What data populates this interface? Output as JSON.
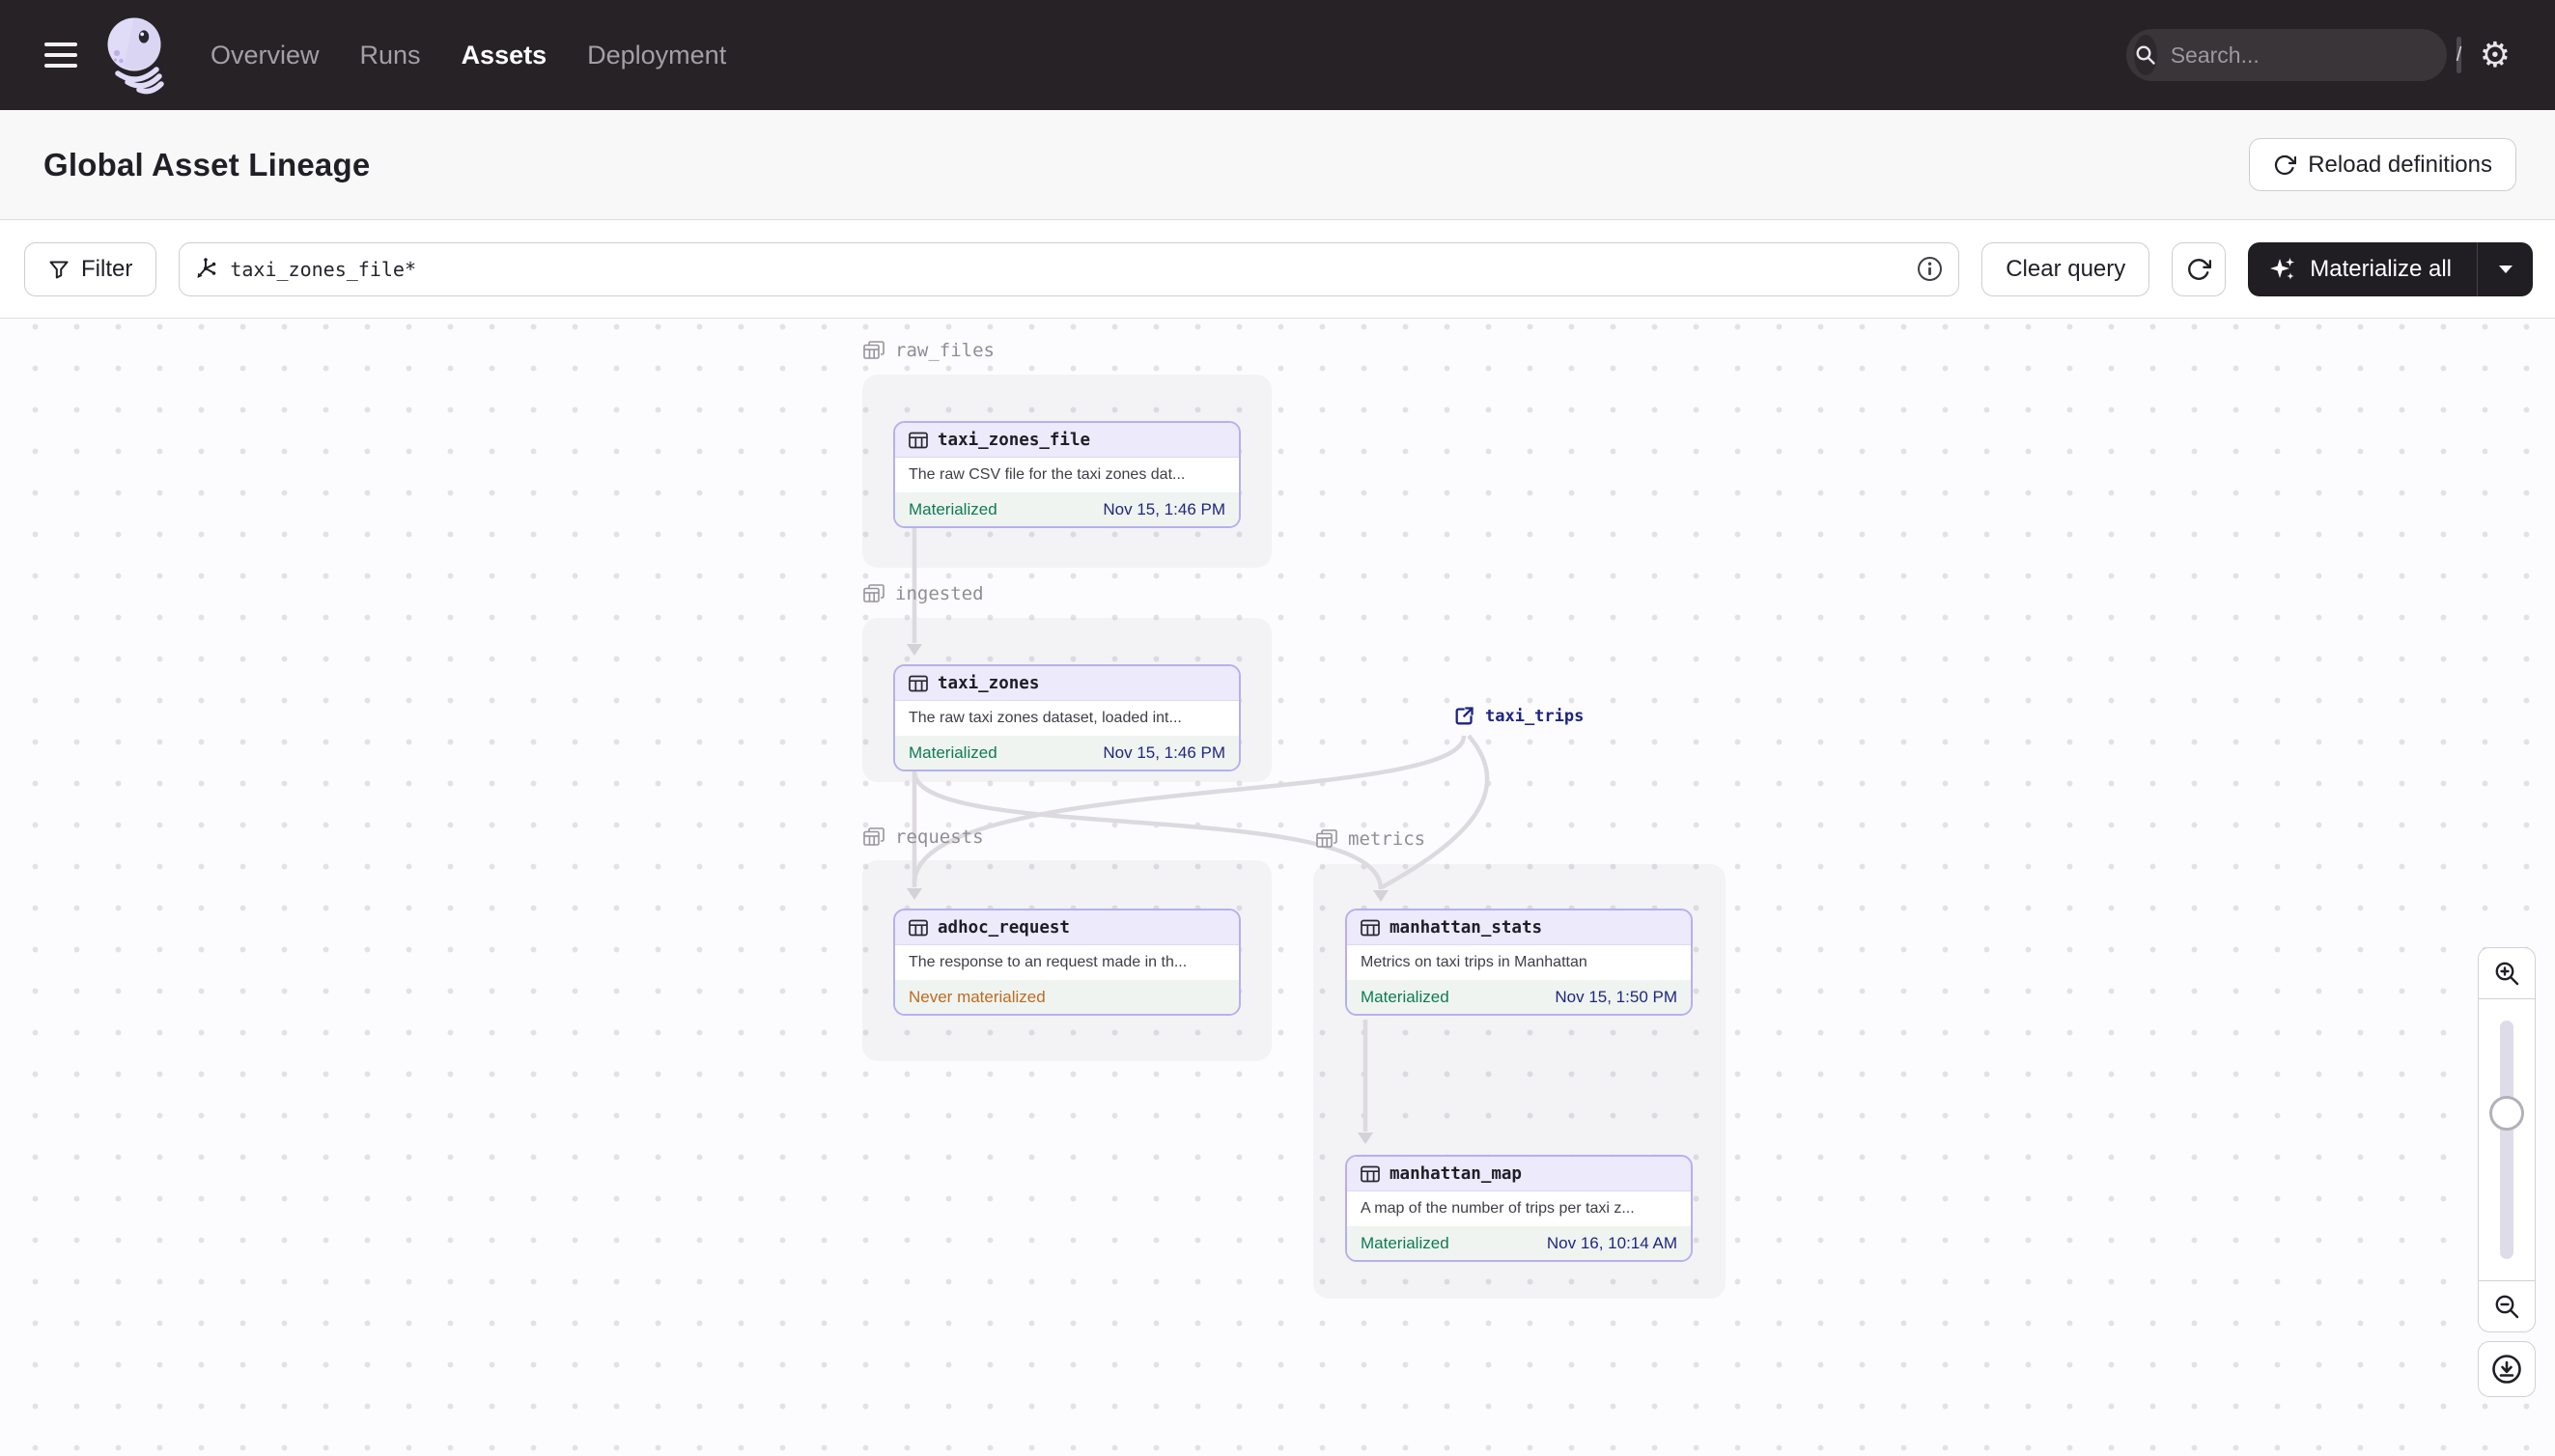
{
  "nav": {
    "menu": [
      {
        "label": "Overview",
        "active": false
      },
      {
        "label": "Runs",
        "active": false
      },
      {
        "label": "Assets",
        "active": true
      },
      {
        "label": "Deployment",
        "active": false
      }
    ],
    "search_placeholder": "Search...",
    "search_shortcut": "/"
  },
  "icons": {
    "gear_glyph": "⚙"
  },
  "header": {
    "title": "Global Asset Lineage",
    "reload_label": "Reload definitions"
  },
  "toolbar": {
    "filter_label": "Filter",
    "query_value": "taxi_zones_file*",
    "clear_label": "Clear query",
    "materialize_label": "Materialize all"
  },
  "graph": {
    "groups": [
      {
        "name": "raw_files"
      },
      {
        "name": "ingested"
      },
      {
        "name": "requests"
      },
      {
        "name": "metrics"
      }
    ],
    "nodes": [
      {
        "name": "taxi_zones_file",
        "description": "The raw CSV file for the taxi zones dat...",
        "status": "Materialized",
        "timestamp": "Nov 15, 1:46 PM"
      },
      {
        "name": "taxi_zones",
        "description": "The raw taxi zones dataset, loaded int...",
        "status": "Materialized",
        "timestamp": "Nov 15, 1:46 PM"
      },
      {
        "name": "adhoc_request",
        "description": "The response to an request made in th...",
        "status": "Never materialized",
        "timestamp": ""
      },
      {
        "name": "manhattan_stats",
        "description": "Metrics on taxi trips in Manhattan",
        "status": "Materialized",
        "timestamp": "Nov 15, 1:50 PM"
      },
      {
        "name": "manhattan_map",
        "description": "A map of the number of trips per taxi z...",
        "status": "Materialized",
        "timestamp": "Nov 16, 10:14 AM"
      }
    ],
    "external_asset": "taxi_trips"
  },
  "colors": {
    "nav_bg": "#262226",
    "node_border": "#B6B0EE",
    "node_header_bg": "#ECEAFB",
    "materialized_green": "#0E7B56",
    "never_materialized_orange": "#BF6A1F",
    "timestamp_navy": "#21267E",
    "external_link_navy": "#1D2483",
    "edge_gray": "#DCDADF"
  }
}
